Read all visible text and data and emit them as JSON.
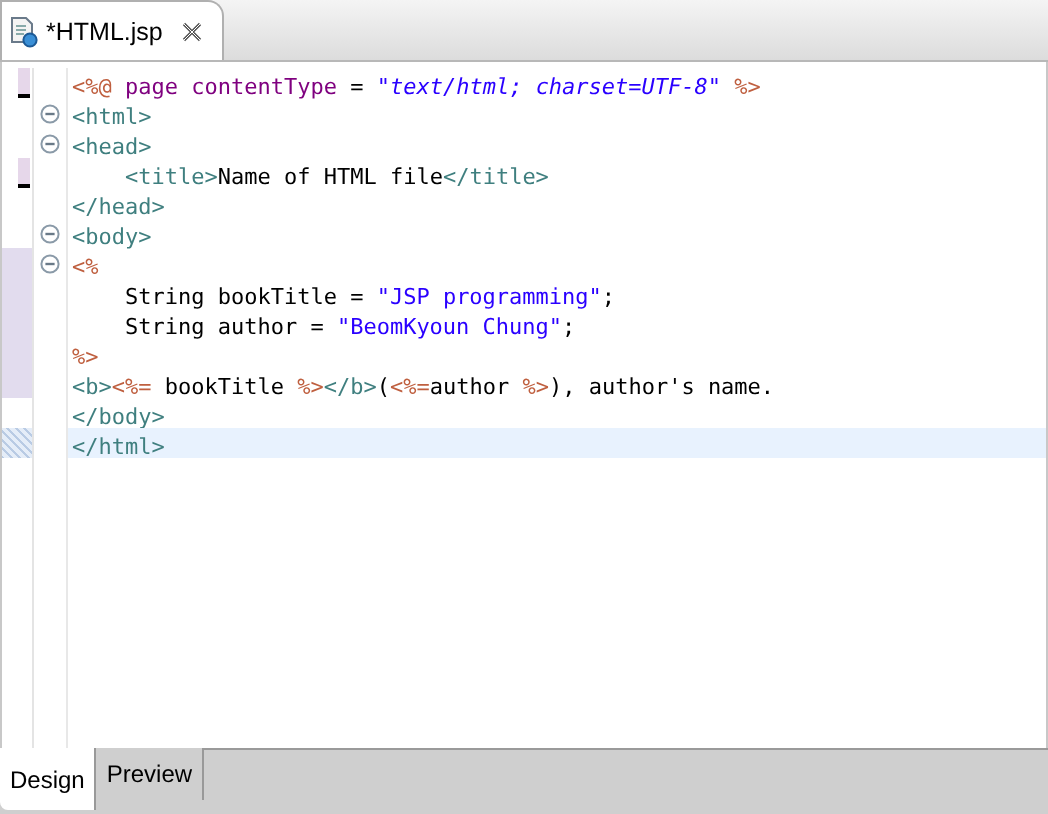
{
  "editor_tab": {
    "title": "*HTML.jsp",
    "selected": true
  },
  "lines": [
    {
      "fold": false,
      "changed": true,
      "block": false,
      "current": false,
      "tokens": [
        {
          "kind": "jsp",
          "text": "<%@"
        },
        {
          "kind": "keyword",
          "text": " page contentType "
        },
        {
          "kind": "text",
          "text": "= "
        },
        {
          "kind": "istring",
          "text": "\"text/html; charset=UTF-8\""
        },
        {
          "kind": "jsp",
          "text": " %>"
        }
      ]
    },
    {
      "fold": true,
      "changed": false,
      "block": false,
      "current": false,
      "tokens": [
        {
          "kind": "tag",
          "text": "<html>"
        }
      ]
    },
    {
      "fold": true,
      "changed": false,
      "block": false,
      "current": false,
      "tokens": [
        {
          "kind": "tag",
          "text": "<head>"
        }
      ]
    },
    {
      "fold": false,
      "changed": true,
      "block": false,
      "current": false,
      "tokens": [
        {
          "kind": "tag",
          "text": "    <title>"
        },
        {
          "kind": "text",
          "text": "Name of HTML file"
        },
        {
          "kind": "tag",
          "text": "</title>"
        }
      ]
    },
    {
      "fold": false,
      "changed": false,
      "block": false,
      "current": false,
      "tokens": [
        {
          "kind": "tag",
          "text": "</head>"
        }
      ]
    },
    {
      "fold": true,
      "changed": false,
      "block": false,
      "current": false,
      "tokens": [
        {
          "kind": "tag",
          "text": "<body>"
        }
      ]
    },
    {
      "fold": true,
      "changed": false,
      "block": true,
      "current": false,
      "tokens": [
        {
          "kind": "jsp",
          "text": "<%"
        }
      ]
    },
    {
      "fold": false,
      "changed": false,
      "block": true,
      "current": false,
      "tokens": [
        {
          "kind": "text",
          "text": "    String bookTitle = "
        },
        {
          "kind": "string",
          "text": "\"JSP programming\""
        },
        {
          "kind": "text",
          "text": ";"
        }
      ]
    },
    {
      "fold": false,
      "changed": false,
      "block": true,
      "current": false,
      "tokens": [
        {
          "kind": "text",
          "text": "    String author = "
        },
        {
          "kind": "string",
          "text": "\"BeomKyoun Chung\""
        },
        {
          "kind": "text",
          "text": ";"
        }
      ]
    },
    {
      "fold": false,
      "changed": false,
      "block": true,
      "current": false,
      "tokens": [
        {
          "kind": "jsp",
          "text": "%>"
        }
      ]
    },
    {
      "fold": false,
      "changed": false,
      "block": true,
      "current": false,
      "tokens": [
        {
          "kind": "tag",
          "text": "<b>"
        },
        {
          "kind": "jsp",
          "text": "<%="
        },
        {
          "kind": "text",
          "text": " bookTitle "
        },
        {
          "kind": "jsp",
          "text": "%>"
        },
        {
          "kind": "tag",
          "text": "</b>"
        },
        {
          "kind": "text",
          "text": "("
        },
        {
          "kind": "jsp",
          "text": "<%="
        },
        {
          "kind": "text",
          "text": "author "
        },
        {
          "kind": "jsp",
          "text": "%>"
        },
        {
          "kind": "text",
          "text": "), author's name."
        }
      ]
    },
    {
      "fold": false,
      "changed": false,
      "block": false,
      "current": false,
      "tokens": [
        {
          "kind": "tag",
          "text": "</body>"
        }
      ]
    },
    {
      "fold": false,
      "changed": false,
      "block": false,
      "current": true,
      "tokens": [
        {
          "kind": "tag",
          "text": "</html>"
        }
      ]
    }
  ],
  "bottom_tabs": [
    {
      "label": "Design",
      "selected": true
    },
    {
      "label": "Preview",
      "selected": false
    }
  ]
}
